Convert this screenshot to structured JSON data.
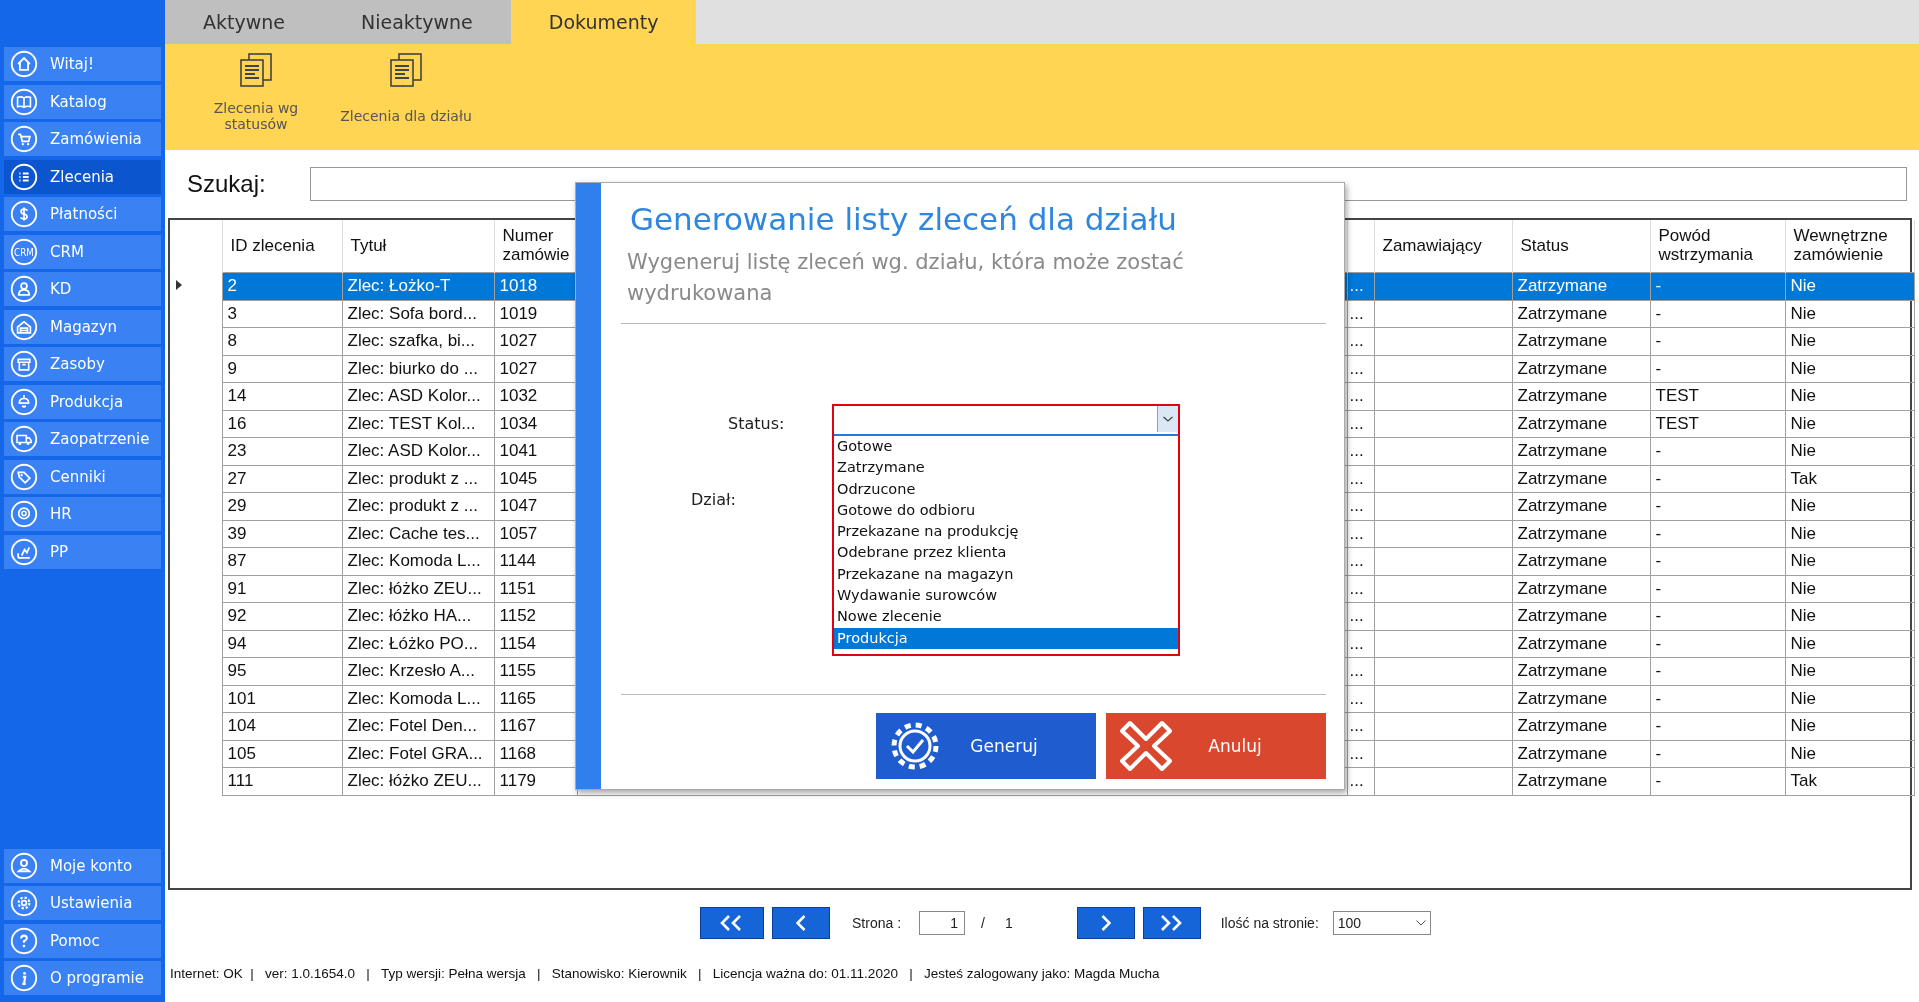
{
  "sidebar": {
    "items": [
      {
        "label": "Witaj!",
        "selected": false
      },
      {
        "label": "Katalog",
        "selected": false
      },
      {
        "label": "Zamówienia",
        "selected": false
      },
      {
        "label": "Zlecenia",
        "selected": true
      },
      {
        "label": "Płatności",
        "selected": false
      },
      {
        "label": "CRM",
        "selected": false,
        "icon_text": "CRM"
      },
      {
        "label": "KD",
        "selected": false
      },
      {
        "label": "Magazyn",
        "selected": false
      },
      {
        "label": "Zasoby",
        "selected": false
      },
      {
        "label": "Produkcja",
        "selected": false
      },
      {
        "label": "Zaopatrzenie",
        "selected": false
      },
      {
        "label": "Cenniki",
        "selected": false
      },
      {
        "label": "HR",
        "selected": false
      },
      {
        "label": "PP",
        "selected": false
      }
    ],
    "bottom_items": [
      {
        "label": "Moje konto",
        "selected": false
      },
      {
        "label": "Ustawienia",
        "selected": false
      },
      {
        "label": "Pomoc",
        "selected": false
      },
      {
        "label": "O programie",
        "selected": false
      }
    ]
  },
  "tabs": [
    {
      "label": "Aktywne",
      "selected": false
    },
    {
      "label": "Nieaktywne",
      "selected": false
    },
    {
      "label": "Dokumenty",
      "selected": true
    }
  ],
  "toolbar": [
    {
      "label": "Zlecenia wg statusów"
    },
    {
      "label": "Zlecenia dla działu"
    }
  ],
  "search": {
    "label": "Szukaj:"
  },
  "table": {
    "columns": [
      "ID zlecenia",
      "Tytuł",
      "Numer zamówie",
      "",
      "",
      "Zamawiający",
      "Status",
      "Powód wstrzymania",
      "Wewnętrzne zamówienie"
    ],
    "rows": [
      {
        "selected": true,
        "cells": [
          "2",
          "Zlec: Łożko-T",
          "1018",
          "",
          "...",
          "",
          "Zatrzymane",
          "-",
          "Nie"
        ]
      },
      {
        "selected": false,
        "cells": [
          "3",
          "Zlec: Sofa bord...",
          "1019",
          "",
          "...",
          "",
          "Zatrzymane",
          "-",
          "Nie"
        ]
      },
      {
        "selected": false,
        "cells": [
          "8",
          "Zlec: szafka, bi...",
          "1027",
          "",
          "...",
          "",
          "Zatrzymane",
          "-",
          "Nie"
        ]
      },
      {
        "selected": false,
        "cells": [
          "9",
          "Zlec: biurko do ...",
          "1027",
          "",
          "...",
          "",
          "Zatrzymane",
          "-",
          "Nie"
        ]
      },
      {
        "selected": false,
        "cells": [
          "14",
          "Zlec: ASD Kolor...",
          "1032",
          "",
          "...",
          "",
          "Zatrzymane",
          "TEST",
          "Nie"
        ]
      },
      {
        "selected": false,
        "cells": [
          "16",
          "Zlec: TEST Kol...",
          "1034",
          "",
          "...",
          "",
          "Zatrzymane",
          "TEST",
          "Nie"
        ]
      },
      {
        "selected": false,
        "cells": [
          "23",
          "Zlec: ASD Kolor...",
          "1041",
          "",
          "...",
          "",
          "Zatrzymane",
          "-",
          "Nie"
        ]
      },
      {
        "selected": false,
        "cells": [
          "27",
          "Zlec: produkt z ...",
          "1045",
          "",
          "...",
          "",
          "Zatrzymane",
          "-",
          "Tak"
        ]
      },
      {
        "selected": false,
        "cells": [
          "29",
          "Zlec: produkt z ...",
          "1047",
          "",
          "...",
          "",
          "Zatrzymane",
          "-",
          "Nie"
        ]
      },
      {
        "selected": false,
        "cells": [
          "39",
          "Zlec: Cache tes...",
          "1057",
          "",
          "...",
          "",
          "Zatrzymane",
          "-",
          "Nie"
        ]
      },
      {
        "selected": false,
        "cells": [
          "87",
          "Zlec: Komoda L...",
          "1144",
          "",
          "...",
          "",
          "Zatrzymane",
          "-",
          "Nie"
        ]
      },
      {
        "selected": false,
        "cells": [
          "91",
          "Zlec: łóżko ZEU...",
          "1151",
          "",
          "...",
          "",
          "Zatrzymane",
          "-",
          "Nie"
        ]
      },
      {
        "selected": false,
        "cells": [
          "92",
          "Zlec: łóżko HA...",
          "1152",
          "",
          "...",
          "",
          "Zatrzymane",
          "-",
          "Nie"
        ]
      },
      {
        "selected": false,
        "cells": [
          "94",
          "Zlec: Łóżko PO...",
          "1154",
          "",
          "...",
          "",
          "Zatrzymane",
          "-",
          "Nie"
        ]
      },
      {
        "selected": false,
        "cells": [
          "95",
          "Zlec: Krzesło A...",
          "1155",
          "",
          "...",
          "",
          "Zatrzymane",
          "-",
          "Nie"
        ]
      },
      {
        "selected": false,
        "cells": [
          "101",
          "Zlec: Komoda L...",
          "1165",
          "",
          "...",
          "",
          "Zatrzymane",
          "-",
          "Nie"
        ]
      },
      {
        "selected": false,
        "cells": [
          "104",
          "Zlec: Fotel Den...",
          "1167",
          "",
          "...",
          "",
          "Zatrzymane",
          "-",
          "Nie"
        ]
      },
      {
        "selected": false,
        "cells": [
          "105",
          "Zlec: Fotel GRA...",
          "1168",
          "",
          "...",
          "",
          "Zatrzymane",
          "-",
          "Nie"
        ]
      },
      {
        "selected": false,
        "cells": [
          "111",
          "Zlec: łóżko ZEU...",
          "1179",
          "",
          "...",
          "",
          "Zatrzymane",
          "-",
          "Tak"
        ]
      }
    ]
  },
  "pagination": {
    "page_label": "Strona :",
    "page": "1",
    "separator": "/",
    "total": "1",
    "per_page_label": "Ilość na stronie:",
    "per_page": "100"
  },
  "status_bar": "Internet: OK  |   ver: 1.0.1654.0   |   Typ wersji: Pełna wersja   |   Stanowisko: Kierownik   |   Licencja ważna do: 01.11.2020   |   Jesteś zalogowany jako: Magda Mucha",
  "dialog": {
    "title": "Generowanie listy zleceń dla działu",
    "subtitle": "Wygeneruj listę zleceń wg. działu, która może zostać wydrukowana",
    "status_label": "Status:",
    "department_label": "Dział:",
    "options": [
      {
        "label": "Gotowe",
        "selected": false
      },
      {
        "label": "Zatrzymane",
        "selected": false
      },
      {
        "label": "Odrzucone",
        "selected": false
      },
      {
        "label": "Gotowe do odbioru",
        "selected": false
      },
      {
        "label": "Przekazane na produkcję",
        "selected": false
      },
      {
        "label": "Odebrane przez klienta",
        "selected": false
      },
      {
        "label": "Przekazane na magazyn",
        "selected": false
      },
      {
        "label": "Wydawanie surowców",
        "selected": false
      },
      {
        "label": "Nowe zlecenie",
        "selected": false
      },
      {
        "label": "Produkcja",
        "selected": true
      }
    ],
    "buttons": [
      {
        "label": "Generuj",
        "kind": "confirm"
      },
      {
        "label": "Anuluj",
        "kind": "cancel"
      }
    ]
  }
}
